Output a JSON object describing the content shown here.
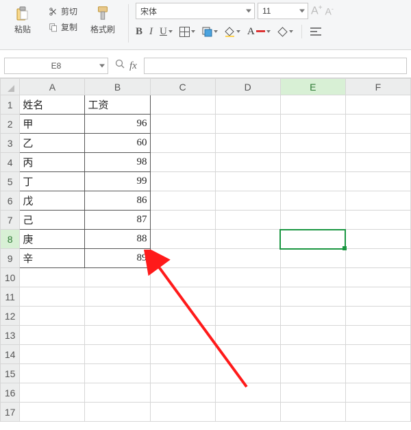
{
  "ribbon": {
    "paste": "粘贴",
    "cut": "剪切",
    "copy": "复制",
    "format_painter": "格式刷",
    "font_name": "宋体",
    "font_size": "11"
  },
  "namebox": {
    "ref": "E8"
  },
  "columns": [
    "A",
    "B",
    "C",
    "D",
    "E",
    "F"
  ],
  "rows": [
    1,
    2,
    3,
    4,
    5,
    6,
    7,
    8,
    9,
    10,
    11,
    12,
    13,
    14,
    15,
    16,
    17
  ],
  "headerRow": {
    "A": "姓名",
    "B": "工资"
  },
  "data": [
    {
      "A": "甲",
      "B": 96
    },
    {
      "A": "乙",
      "B": 60
    },
    {
      "A": "丙",
      "B": 98
    },
    {
      "A": "丁",
      "B": 99
    },
    {
      "A": "戊",
      "B": 86
    },
    {
      "A": "己",
      "B": 87
    },
    {
      "A": "庚",
      "B": 88
    },
    {
      "A": "辛",
      "B": 89
    }
  ],
  "selection": {
    "cell": "E8"
  }
}
